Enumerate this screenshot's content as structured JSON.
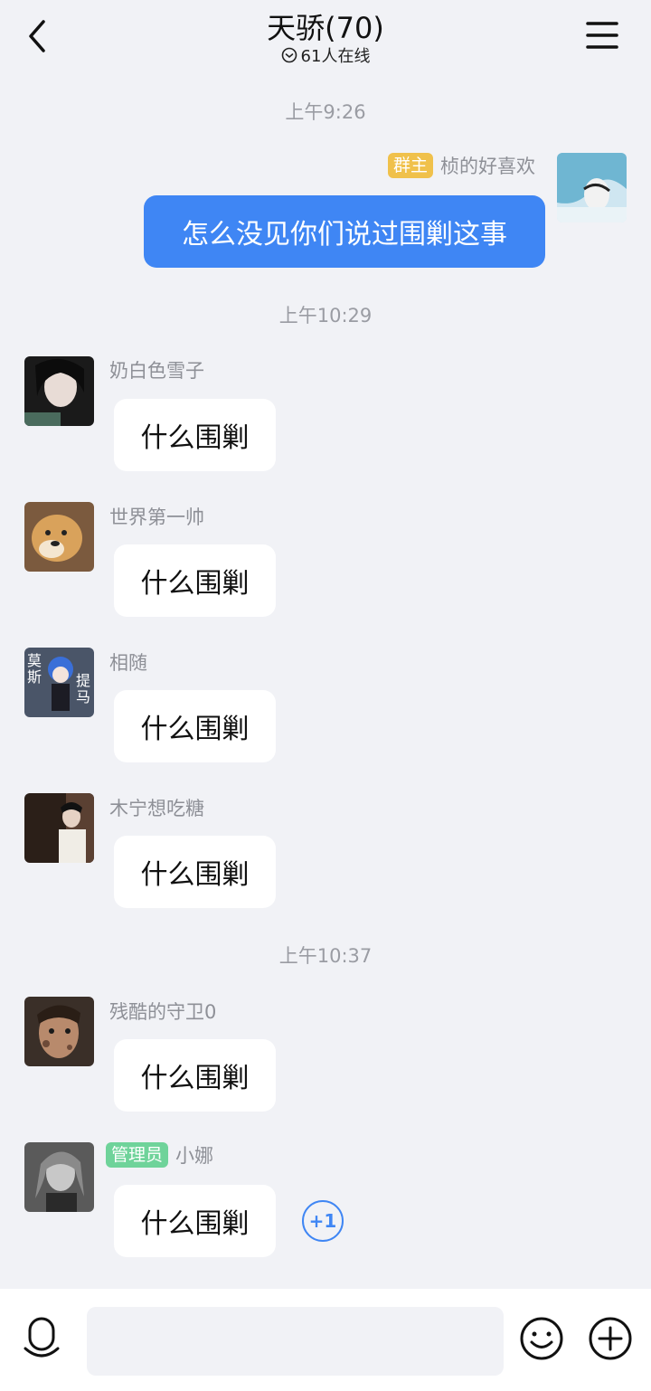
{
  "header": {
    "title": "天骄(70)",
    "online": "61人在线"
  },
  "messages": {
    "t1": "上午9:26",
    "self_badge": "群主",
    "self_name": "桢的好喜欢",
    "self_text": "怎么没见你们说过围剿这事",
    "t2": "上午10:29",
    "m1_name": "奶白色雪子",
    "m1_text": "什么围剿",
    "m2_name": "世界第一帅",
    "m2_text": "什么围剿",
    "m3_name": "相随",
    "m3_avatar_left": "莫\n斯",
    "m3_avatar_right": "提\n马",
    "m3_text": "什么围剿",
    "m4_name": "木宁想吃糖",
    "m4_text": "什么围剿",
    "t3": "上午10:37",
    "m5_name": "残酷的守卫0",
    "m5_text": "什么围剿",
    "m6_badge": "管理员",
    "m6_name": "小娜",
    "m6_text": "什么围剿",
    "plus_one": "+1"
  },
  "colors": {
    "accent": "#3f86f4",
    "owner_badge": "#f0c14b",
    "admin_badge": "#6fd39a",
    "background": "#f1f2f6"
  },
  "icons": [
    "back-icon",
    "menu-icon",
    "online-icon",
    "voice-icon",
    "emoji-icon",
    "plus-icon"
  ]
}
